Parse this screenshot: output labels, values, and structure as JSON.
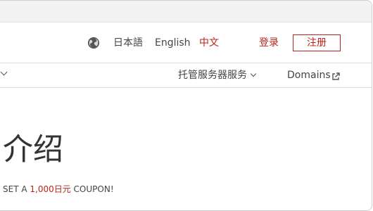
{
  "header": {
    "languages": [
      {
        "label": "日本語",
        "active": false
      },
      {
        "label": "English",
        "active": false
      },
      {
        "label": "中文",
        "active": true
      }
    ],
    "login_label": "登录",
    "register_label": "注册"
  },
  "nav": {
    "hosting_label": "托管服务器服务",
    "domains_label": "Domains"
  },
  "hero": {
    "title": "介绍",
    "promo_prefix": "SET A ",
    "promo_amount": "1,000日元",
    "promo_suffix": " COUPON!"
  },
  "colors": {
    "accent": "#b8241b",
    "text": "#333333",
    "border": "#dcdcdc"
  },
  "icons": {
    "globe": "globe-icon",
    "external": "external-link-icon",
    "chevron": "chevron-down-icon"
  }
}
